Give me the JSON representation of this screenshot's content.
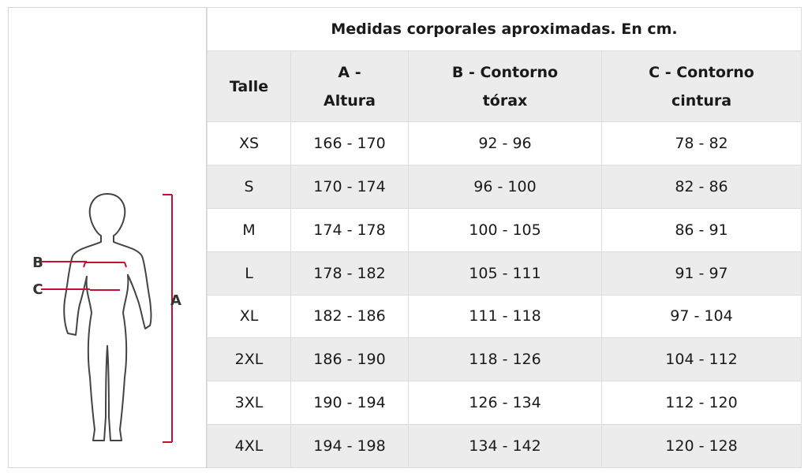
{
  "figure": {
    "label_a": "A",
    "label_b": "B",
    "label_c": "C",
    "line_color": "#c8102e"
  },
  "table": {
    "title": "Medidas corporales aproximadas. En cm.",
    "headers": {
      "talle": "Talle",
      "a_line1": "A -",
      "a_line2": "Altura",
      "b_line1": "B - Contorno",
      "b_line2": "tórax",
      "c_line1": "C - Contorno",
      "c_line2": "cintura"
    },
    "rows": [
      {
        "talle": "XS",
        "altura": "166 - 170",
        "torax": "92 - 96",
        "cintura": "78 - 82"
      },
      {
        "talle": "S",
        "altura": "170 - 174",
        "torax": "96 - 100",
        "cintura": "82 - 86"
      },
      {
        "talle": "M",
        "altura": "174 - 178",
        "torax": "100 - 105",
        "cintura": "86 - 91"
      },
      {
        "talle": "L",
        "altura": "178 - 182",
        "torax": "105 - 111",
        "cintura": "91 - 97"
      },
      {
        "talle": "XL",
        "altura": "182 - 186",
        "torax": "111 - 118",
        "cintura": "97 - 104"
      },
      {
        "talle": "2XL",
        "altura": "186 - 190",
        "torax": "118 - 126",
        "cintura": "104 - 112"
      },
      {
        "talle": "3XL",
        "altura": "190 - 194",
        "torax": "126 - 134",
        "cintura": "112 - 120"
      },
      {
        "talle": "4XL",
        "altura": "194 - 198",
        "torax": "134 - 142",
        "cintura": "120 - 128"
      }
    ]
  }
}
